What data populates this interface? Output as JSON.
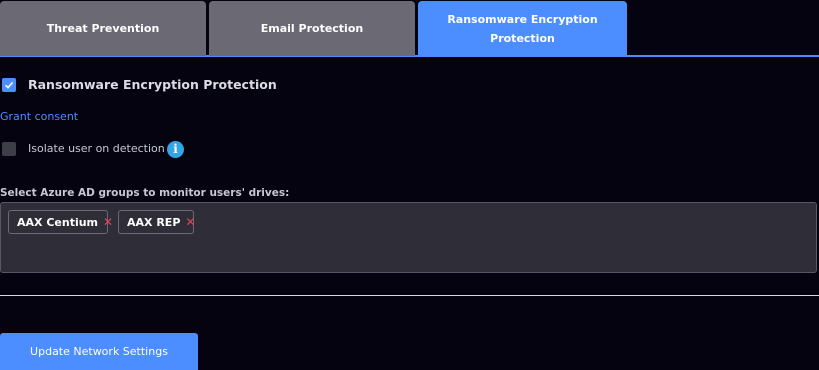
{
  "tabs": [
    {
      "label": "Threat Prevention",
      "active": false
    },
    {
      "label": "Email Protection",
      "active": false
    },
    {
      "label": "Ransomware Encryption Protection",
      "active": true
    }
  ],
  "ransomware": {
    "enabled": true,
    "title": "Ransomware Encryption Protection",
    "grant_consent_label": "Grant consent",
    "isolate_user": {
      "checked": false,
      "label": "Isolate user on detection",
      "info_glyph": "i"
    }
  },
  "groups": {
    "label": "Select Azure AD groups to monitor users' drives:",
    "selected": [
      {
        "name": "AAX Centium",
        "remove_glyph": "✕"
      },
      {
        "name": "AAX REP",
        "remove_glyph": "✕"
      }
    ]
  },
  "actions": {
    "update_label": "Update Network Settings"
  },
  "colors": {
    "accent": "#4c8dff",
    "background": "#04030f",
    "inactive_tab": "#6b6a74",
    "remove": "#e0455b",
    "info": "#35a4e4"
  },
  "icons": {
    "checkbox_checked": "check-icon",
    "info": "info-icon",
    "remove": "close-icon"
  }
}
